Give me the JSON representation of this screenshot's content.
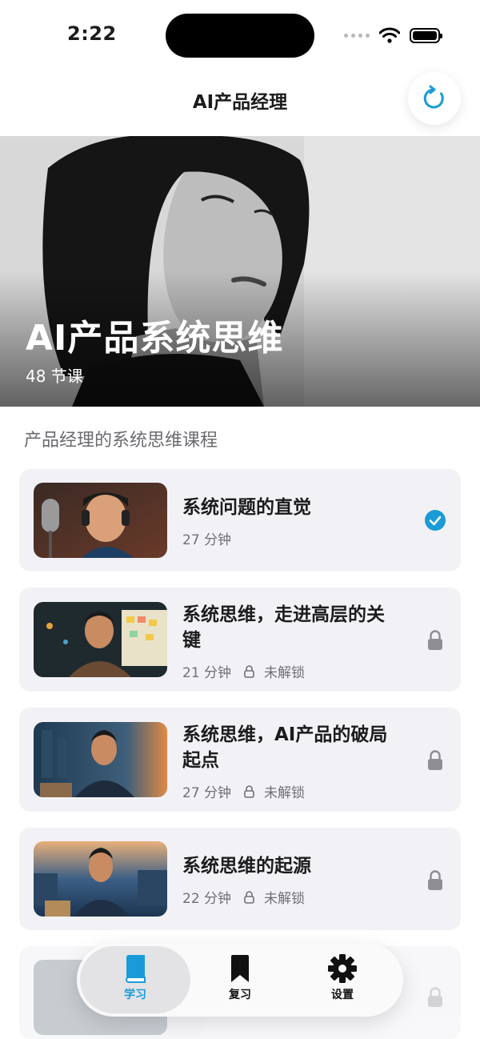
{
  "status_bar": {
    "time": "2:22"
  },
  "nav": {
    "title": "AI产品经理"
  },
  "hero": {
    "title": "AI产品系统思维",
    "lesson_count": "48 节课"
  },
  "section": {
    "subtitle": "产品经理的系统思维课程"
  },
  "lessons": [
    {
      "title": "系统问题的直觉",
      "duration": "27 分钟",
      "lock_text": "",
      "status": "completed"
    },
    {
      "title": "系统思维，走进高层的关键",
      "duration": "21 分钟",
      "lock_text": "未解锁",
      "status": "locked"
    },
    {
      "title": "系统思维，AI产品的破局起点",
      "duration": "27 分钟",
      "lock_text": "未解锁",
      "status": "locked"
    },
    {
      "title": "系统思维的起源",
      "duration": "22 分钟",
      "lock_text": "未解锁",
      "status": "locked"
    }
  ],
  "tabs": [
    {
      "label": "学习",
      "icon": "book-icon",
      "active": true
    },
    {
      "label": "复习",
      "icon": "bookmark-icon",
      "active": false
    },
    {
      "label": "设置",
      "icon": "gear-icon",
      "active": false
    }
  ],
  "colors": {
    "accent": "#1a9bd7",
    "card_bg": "#f2f2f6",
    "lock_gray": "#8e8e93"
  }
}
